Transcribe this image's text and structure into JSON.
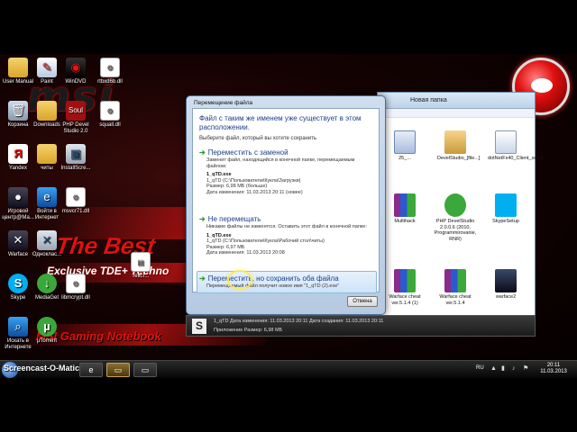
{
  "desktop": {
    "brand_line1": "The Best",
    "brand_line2": "Exclusive TDE+ Techno",
    "brand_line3": "MSI Gaming Notebook",
    "logo_text": "msi",
    "icons": [
      {
        "label": "User Manual",
        "icon": "folder-icon"
      },
      {
        "label": "Paint",
        "icon": "paint-icon"
      },
      {
        "label": "WinDVD",
        "icon": "dvd-icon"
      },
      {
        "label": "Корзина",
        "icon": "recycle-bin-icon"
      },
      {
        "label": "Downloads",
        "icon": "downloads-folder-icon"
      },
      {
        "label": "PHP Devel Studio 2.0",
        "icon": "soul-app-icon"
      },
      {
        "label": "Yandex",
        "icon": "yandex-icon"
      },
      {
        "label": "читы",
        "icon": "folder-icon"
      },
      {
        "label": "InstallScre...",
        "icon": "installer-icon"
      },
      {
        "label": "Игровой центр@Ма...",
        "icon": "game-center-icon"
      },
      {
        "label": "Войти в Интернет",
        "icon": "internet-explorer-icon"
      },
      {
        "label": "msvcr71.dll",
        "icon": "dll-icon"
      },
      {
        "label": "Warface",
        "icon": "warface-icon"
      },
      {
        "label": "Одноклас...",
        "icon": "odnoklassniki-icon"
      },
      {
        "label": "Skype",
        "icon": "skype-icon"
      },
      {
        "label": "MediaGet",
        "icon": "mediaget-icon"
      },
      {
        "label": "libmcrypt.dll",
        "icon": "dll-icon"
      },
      {
        "label": "Искать в Интернете",
        "icon": "search-internet-icon"
      },
      {
        "label": "µTorrent",
        "icon": "utorrent-icon"
      },
      {
        "label": "rtbxd6b.dll",
        "icon": "dll-icon"
      },
      {
        "label": "squall.dll",
        "icon": "dll-icon"
      },
      {
        "label": "текст...",
        "icon": "text-file-icon"
      }
    ]
  },
  "explorer": {
    "toolbar_text": "Новая папка",
    "items": [
      {
        "label": "25_...",
        "icon": "word-doc-icon"
      },
      {
        "label": "DevelStudio_[file...]",
        "icon": "archive-box-icon"
      },
      {
        "label": "dotNetFx40_Client_setup",
        "icon": "installer-icon"
      },
      {
        "label": "Multihack",
        "icon": "winrar-icon"
      },
      {
        "label": "PHP DevelStudio 2.0.0.6 (2010, Programmirovanie, RNR)",
        "icon": "utorrent-icon"
      },
      {
        "label": "SkypeSetup",
        "icon": "skype-setup-icon"
      },
      {
        "label": "Warface cheat ver.5.1.4 (1)",
        "icon": "winrar-icon"
      },
      {
        "label": "Warface cheat ver.5.1.4",
        "icon": "winrar-icon"
      },
      {
        "label": "warface2",
        "icon": "photo-icon"
      }
    ]
  },
  "dialog": {
    "title": "Перемещение файла",
    "heading": "Файл с таким же именем уже существует в этом расположении.",
    "subheading": "Выберите файл, который вы хотите сохранить",
    "options": [
      {
        "title": "Переместить с заменой",
        "description": "Заменит файл, находящийся в конечной папке, перемещаемым файлом:",
        "file_name": "1_qTD.exe",
        "file_path": "1_qTD (C:\\Пользователи\\Кукла\\Загрузки)",
        "file_size": "Размер: 6,98 МБ (больше)",
        "file_date": "Дата изменения: 11.03.2013 20:11 (новее)"
      },
      {
        "title": "Не перемещать",
        "description": "Никакие файлы не изменятся. Оставить этот файл в конечной папке:",
        "file_name": "1_qTD.exe",
        "file_path": "1_qTD (C:\\Пользователи\\Кукла\\Рабочий стол\\читы)",
        "file_size": "Размер: 6,97 МБ",
        "file_date": "Дата изменения: 11.03.2013 20:08"
      },
      {
        "title": "Переместить, но сохранить оба файла",
        "description": "Перемещаемый файл получит новое имя \"1_qTD (2).exe\""
      }
    ],
    "cancel_label": "Отмена"
  },
  "file_strip": {
    "line1": "1_qTD          Дата изменения: 11.03.2013 20:11   Дата создания: 11.03.2013 20:11",
    "line2": "Приложение              Размер: 6,98 МБ",
    "icon": "s-app-icon"
  },
  "taskbar": {
    "watermark": "Screencast-O-Matic.com",
    "language": "RU",
    "time": "20:11",
    "date": "11.03.2013"
  }
}
